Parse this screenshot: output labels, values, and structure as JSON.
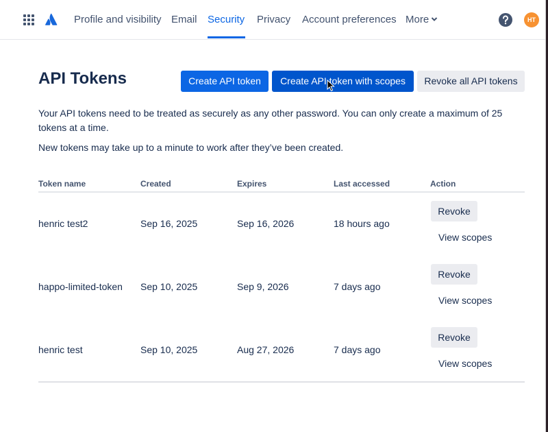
{
  "nav": {
    "items": [
      "Profile and visibility",
      "Email",
      "Security",
      "Privacy",
      "Account preferences",
      "More"
    ],
    "active": "Security",
    "avatar_initials": "HT",
    "accent_color": "#0c66e4"
  },
  "page": {
    "title": "API Tokens",
    "buttons": {
      "create": "Create API token",
      "create_scoped": "Create API token with scopes",
      "revoke_all": "Revoke all API tokens"
    },
    "description_1": "Your API tokens need to be treated as securely as any other password. You can only create a maximum of 25 tokens at a time.",
    "description_2": "New tokens may take up to a minute to work after they’ve been created."
  },
  "table": {
    "headers": [
      "Token name",
      "Created",
      "Expires",
      "Last accessed",
      "Action"
    ],
    "rows": [
      {
        "name": "henric test2",
        "created": "Sep 16, 2025",
        "expires": "Sep 16, 2026",
        "last_accessed": "18 hours ago",
        "revoke": "Revoke",
        "view_scopes": "View scopes"
      },
      {
        "name": "happo-limited-token",
        "created": "Sep 10, 2025",
        "expires": "Sep 9, 2026",
        "last_accessed": "7 days ago",
        "revoke": "Revoke",
        "view_scopes": "View scopes"
      },
      {
        "name": "henric test",
        "created": "Sep 10, 2025",
        "expires": "Aug 27, 2026",
        "last_accessed": "7 days ago",
        "revoke": "Revoke",
        "view_scopes": "View scopes"
      }
    ]
  }
}
